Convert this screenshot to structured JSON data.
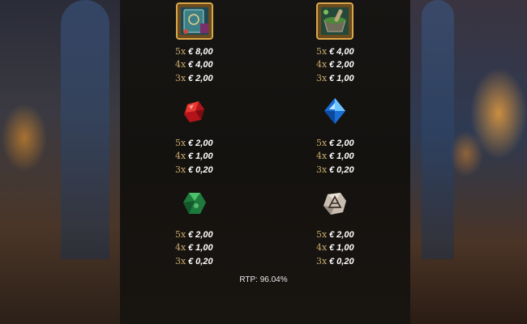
{
  "paytable": {
    "symbols": [
      {
        "name": "book",
        "icon": "spellbook-icon",
        "pays": [
          {
            "mult": "5x",
            "amount": "€ 8,00"
          },
          {
            "mult": "4x",
            "amount": "€ 4,00"
          },
          {
            "mult": "3x",
            "amount": "€ 2,00"
          }
        ]
      },
      {
        "name": "mortar",
        "icon": "mortar-pestle-icon",
        "pays": [
          {
            "mult": "5x",
            "amount": "€ 4,00"
          },
          {
            "mult": "4x",
            "amount": "€ 2,00"
          },
          {
            "mult": "3x",
            "amount": "€ 1,00"
          }
        ]
      },
      {
        "name": "red-gem",
        "icon": "red-gem-icon",
        "pays": [
          {
            "mult": "5x",
            "amount": "€ 2,00"
          },
          {
            "mult": "4x",
            "amount": "€ 1,00"
          },
          {
            "mult": "3x",
            "amount": "€ 0,20"
          }
        ]
      },
      {
        "name": "blue-gem",
        "icon": "blue-gem-icon",
        "pays": [
          {
            "mult": "5x",
            "amount": "€ 2,00"
          },
          {
            "mult": "4x",
            "amount": "€ 1,00"
          },
          {
            "mult": "3x",
            "amount": "€ 0,20"
          }
        ]
      },
      {
        "name": "green-gem",
        "icon": "green-gem-icon",
        "pays": [
          {
            "mult": "5x",
            "amount": "€ 2,00"
          },
          {
            "mult": "4x",
            "amount": "€ 1,00"
          },
          {
            "mult": "3x",
            "amount": "€ 0,20"
          }
        ]
      },
      {
        "name": "rune-stone",
        "icon": "rune-stone-icon",
        "pays": [
          {
            "mult": "5x",
            "amount": "€ 2,00"
          },
          {
            "mult": "4x",
            "amount": "€ 1,00"
          },
          {
            "mult": "3x",
            "amount": "€ 0,20"
          }
        ]
      }
    ]
  },
  "rtp_text": "RTP: 96.04%",
  "colors": {
    "multiplier": "#c8a96a",
    "amount": "#ffffff",
    "panel": "#171513"
  }
}
